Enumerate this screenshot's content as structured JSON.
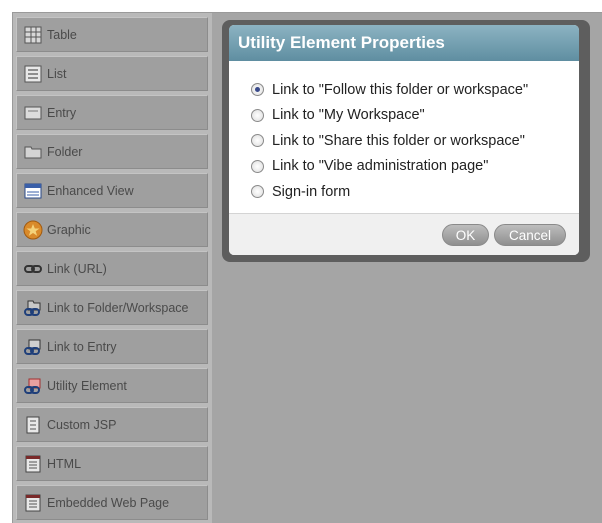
{
  "palette": {
    "items": [
      {
        "label": "Table",
        "icon": "table-icon"
      },
      {
        "label": "List",
        "icon": "list-icon"
      },
      {
        "label": "Entry",
        "icon": "entry-icon"
      },
      {
        "label": "Folder",
        "icon": "folder-icon"
      },
      {
        "label": "Enhanced View",
        "icon": "enhanced-view-icon"
      },
      {
        "label": "Graphic",
        "icon": "graphic-icon"
      },
      {
        "label": "Link (URL)",
        "icon": "link-icon"
      },
      {
        "label": "Link to Folder/Workspace",
        "icon": "link-folder-icon"
      },
      {
        "label": "Link to Entry",
        "icon": "link-entry-icon"
      },
      {
        "label": "Utility Element",
        "icon": "utility-element-icon"
      },
      {
        "label": "Custom JSP",
        "icon": "custom-jsp-icon"
      },
      {
        "label": "HTML",
        "icon": "html-icon"
      },
      {
        "label": "Embedded Web Page",
        "icon": "embedded-web-page-icon"
      }
    ]
  },
  "dialog": {
    "title": "Utility Element Properties",
    "options": [
      {
        "label": "Link to \"Follow this folder or workspace\"",
        "checked": true
      },
      {
        "label": "Link to \"My Workspace\"",
        "checked": false
      },
      {
        "label": "Link to \"Share this folder or workspace\"",
        "checked": false
      },
      {
        "label": "Link to \"Vibe administration page\"",
        "checked": false
      },
      {
        "label": "Sign-in form",
        "checked": false
      }
    ],
    "ok_label": "OK",
    "cancel_label": "Cancel"
  },
  "colors": {
    "header_top": "#8cb3c2",
    "header_bottom": "#5f8ea1",
    "sidebar_bg": "#b9b9b9",
    "main_bg": "#a5a5a5"
  }
}
